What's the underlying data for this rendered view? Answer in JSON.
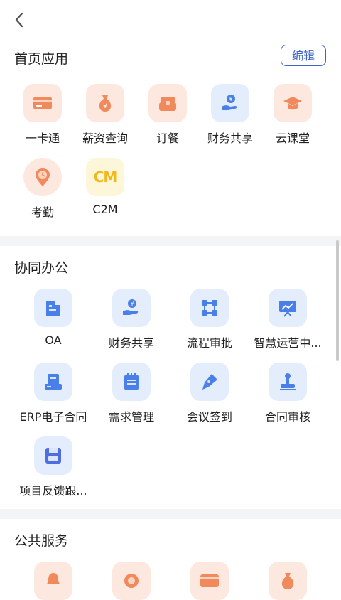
{
  "header": {
    "back_icon": "chevron-left-icon"
  },
  "home_apps": {
    "title": "首页应用",
    "edit_label": "编辑",
    "items": [
      {
        "label": "一卡通",
        "icon": "card-icon",
        "tone": "warm"
      },
      {
        "label": "薪资查询",
        "icon": "money-bag-icon",
        "tone": "warm"
      },
      {
        "label": "订餐",
        "icon": "food-box-icon",
        "tone": "warm"
      },
      {
        "label": "财务共享",
        "icon": "finance-hand-icon",
        "tone": "blue"
      },
      {
        "label": "云课堂",
        "icon": "graduation-cap-icon",
        "tone": "warm"
      },
      {
        "label": "考勤",
        "icon": "clock-pin-icon",
        "tone": "warm"
      },
      {
        "label": "C2M",
        "icon": "c2m-logo-icon",
        "tone": "yellow"
      }
    ]
  },
  "collab": {
    "title": "协同办公",
    "items": [
      {
        "label": "OA",
        "icon": "building-icon"
      },
      {
        "label": "财务共享",
        "icon": "finance-hand-icon"
      },
      {
        "label": "流程审批",
        "icon": "flow-nodes-icon"
      },
      {
        "label": "智慧运营中...",
        "icon": "presentation-chart-icon"
      },
      {
        "label": "ERP电子合同",
        "icon": "document-tray-icon"
      },
      {
        "label": "需求管理",
        "icon": "notepad-icon"
      },
      {
        "label": "会议签到",
        "icon": "pen-nib-icon"
      },
      {
        "label": "合同审核",
        "icon": "stamp-icon"
      },
      {
        "label": "项目反馈跟...",
        "icon": "floppy-disk-icon"
      }
    ]
  },
  "public": {
    "title": "公共服务",
    "items": [
      {
        "icon": "bell-icon"
      },
      {
        "icon": "target-icon"
      },
      {
        "icon": "card-icon"
      },
      {
        "icon": "money-bag-icon"
      }
    ]
  },
  "colors": {
    "accent": "#3d63c9",
    "warm_icon": "#f08a5d",
    "blue_icon": "#4a7ee8"
  }
}
